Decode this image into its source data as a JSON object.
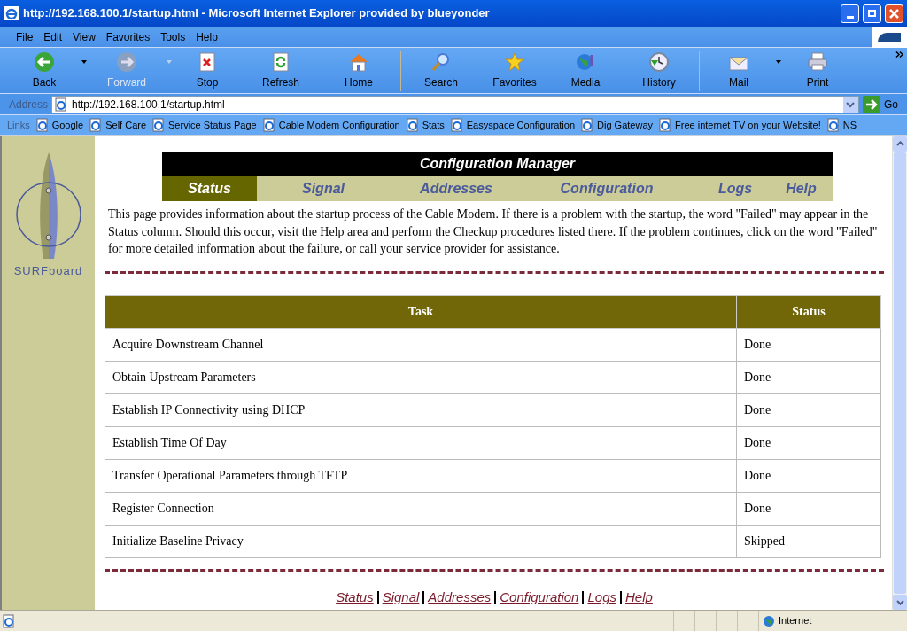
{
  "window": {
    "title": "http://192.168.100.1/startup.html - Microsoft Internet Explorer provided by blueyonder"
  },
  "menu": [
    "File",
    "Edit",
    "View",
    "Favorites",
    "Tools",
    "Help"
  ],
  "toolbar": [
    {
      "kind": "back",
      "label": "Back",
      "disabled": false,
      "dropdown": true
    },
    {
      "kind": "forward",
      "label": "Forward",
      "disabled": true,
      "dropdown": true
    },
    {
      "kind": "stop",
      "label": "Stop",
      "disabled": false,
      "dropdown": false
    },
    {
      "kind": "refresh",
      "label": "Refresh",
      "disabled": false,
      "dropdown": false
    },
    {
      "kind": "home",
      "label": "Home",
      "disabled": false,
      "dropdown": false
    },
    {
      "kind": "search",
      "label": "Search",
      "disabled": false,
      "dropdown": false
    },
    {
      "kind": "favorites",
      "label": "Favorites",
      "disabled": false,
      "dropdown": false
    },
    {
      "kind": "media",
      "label": "Media",
      "disabled": false,
      "dropdown": false
    },
    {
      "kind": "history",
      "label": "History",
      "disabled": false,
      "dropdown": false
    },
    {
      "kind": "mail",
      "label": "Mail",
      "disabled": false,
      "dropdown": true
    },
    {
      "kind": "print",
      "label": "Print",
      "disabled": false,
      "dropdown": false
    }
  ],
  "address": {
    "label": "Address",
    "value": "http://192.168.100.1/startup.html",
    "go": "Go"
  },
  "links": {
    "label": "Links",
    "items": [
      "Google",
      "Self Care",
      "Service Status Page",
      "Cable Modem Configuration",
      "Stats",
      "Easyspace Configuration",
      "Dig Gateway",
      "Free internet TV on your Website!",
      "NS"
    ]
  },
  "page": {
    "logo_text": "SURFboard",
    "header": "Configuration Manager",
    "tabs": [
      {
        "label": "Status",
        "selected": true
      },
      {
        "label": "Signal",
        "selected": false
      },
      {
        "label": "Addresses",
        "selected": false
      },
      {
        "label": "Configuration",
        "selected": false
      },
      {
        "label": "Logs",
        "selected": false
      },
      {
        "label": "Help",
        "selected": false
      }
    ],
    "intro": "This page provides information about the startup process of the Cable Modem. If there is a problem with the startup, the word \"Failed\" may appear in the Status column. Should this occur, visit the Help area and perform the Checkup procedures listed there. If the problem continues, click on the word \"Failed\" for more detailed information about the failure, or call your service provider for assistance.",
    "table": {
      "columns": [
        "Task",
        "Status"
      ],
      "rows": [
        [
          "Acquire Downstream Channel",
          "Done"
        ],
        [
          "Obtain Upstream Parameters",
          "Done"
        ],
        [
          "Establish IP Connectivity using DHCP",
          "Done"
        ],
        [
          "Establish Time Of Day",
          "Done"
        ],
        [
          "Transfer Operational Parameters through TFTP",
          "Done"
        ],
        [
          "Register Connection",
          "Done"
        ],
        [
          "Initialize Baseline Privacy",
          "Skipped"
        ]
      ]
    },
    "footer_links": [
      "Status",
      "Signal",
      "Addresses",
      "Configuration",
      "Logs",
      "Help"
    ]
  },
  "status_bar": {
    "zone": "Internet"
  }
}
